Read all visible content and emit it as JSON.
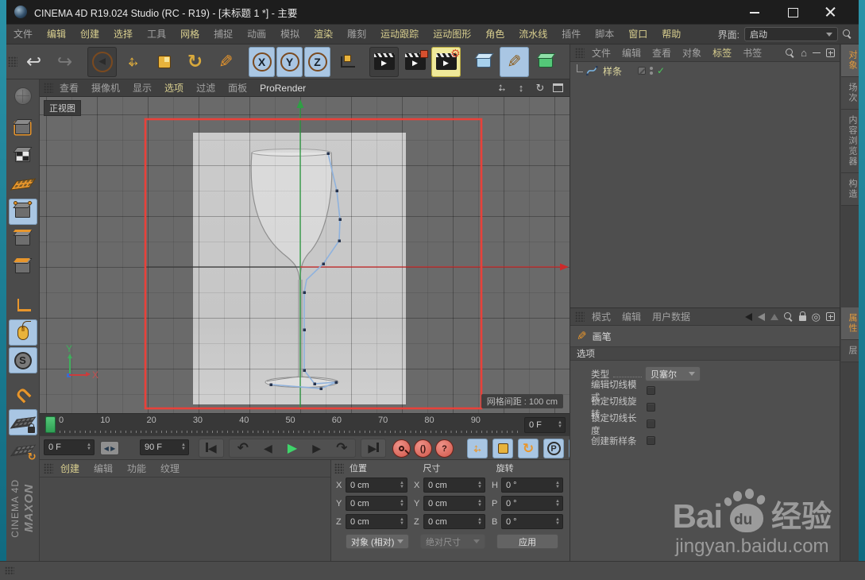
{
  "colors": {
    "desktop_teal": "#177f95",
    "accent_yellow": "#d9cf8f",
    "tab_active_orange": "#e09a3e",
    "render_frame_red": "#e8413a",
    "spline_blue": "#8fb2dd",
    "play_green": "#3fae5c",
    "record_red": "#d1574a",
    "toggle_blue": "#a9c6e3",
    "viewport_gray": "#6a6a6a",
    "reference_image_gray": "#c9c9c9"
  },
  "titlebar": {
    "title": "CINEMA 4D R19.024 Studio (RC - R19) - [未标题 1 *] - 主要"
  },
  "menubar": {
    "items": [
      {
        "label": "文件",
        "cls": "dim"
      },
      {
        "label": "编辑",
        "cls": "bright"
      },
      {
        "label": "创建",
        "cls": "bright"
      },
      {
        "label": "选择",
        "cls": "bright"
      },
      {
        "label": "工具",
        "cls": "dim"
      },
      {
        "label": "网格",
        "cls": "bright"
      },
      {
        "label": "捕捉",
        "cls": "dim"
      },
      {
        "label": "动画",
        "cls": "dim"
      },
      {
        "label": "模拟",
        "cls": "dim"
      },
      {
        "label": "渲染",
        "cls": "bright"
      },
      {
        "label": "雕刻",
        "cls": "dim"
      },
      {
        "label": "运动跟踪",
        "cls": "bright"
      },
      {
        "label": "运动图形",
        "cls": "bright"
      },
      {
        "label": "角色",
        "cls": "bright"
      },
      {
        "label": "流水线",
        "cls": "bright"
      },
      {
        "label": "插件",
        "cls": "dim"
      },
      {
        "label": "脚本",
        "cls": "dim"
      },
      {
        "label": "窗口",
        "cls": "bright"
      },
      {
        "label": "帮助",
        "cls": "bright"
      }
    ],
    "interface_label": "界面:",
    "interface_value": "启动"
  },
  "toolbar": {
    "axis": [
      "X",
      "Y",
      "Z"
    ]
  },
  "left_toolbar": {
    "snap_letter": "S",
    "maxon": "MAXON",
    "cinema": "CINEMA 4D"
  },
  "viewport": {
    "menu": [
      {
        "label": "查看",
        "cls": "dim"
      },
      {
        "label": "摄像机",
        "cls": "dim"
      },
      {
        "label": "显示",
        "cls": "dim"
      },
      {
        "label": "选项",
        "cls": "bright"
      },
      {
        "label": "过滤",
        "cls": "dim"
      },
      {
        "label": "面板",
        "cls": "dim"
      },
      {
        "label": "ProRender",
        "cls": "white"
      }
    ],
    "view_label": "正视图",
    "grid_spacing": "网格间距 : 100 cm",
    "axis_y": "Y",
    "axis_x": "X"
  },
  "object_manager": {
    "menu": [
      {
        "label": "文件",
        "cls": "dim"
      },
      {
        "label": "编辑",
        "cls": "dim"
      },
      {
        "label": "查看",
        "cls": "dim"
      },
      {
        "label": "对象",
        "cls": "dim"
      },
      {
        "label": "标签",
        "cls": "bright"
      },
      {
        "label": "书签",
        "cls": "dim"
      }
    ],
    "object_name": "样条"
  },
  "attribute_manager": {
    "menu": [
      "模式",
      "编辑",
      "用户数据"
    ],
    "tool_title": "画笔",
    "section": "选项",
    "type_label": "类型",
    "type_value": "贝塞尔",
    "checkboxes": [
      "编辑切线模式",
      "锁定切线旋转",
      "锁定切线长度",
      "创建新样条"
    ]
  },
  "right_tabs": {
    "top": [
      {
        "label": "对象",
        "cls": "active"
      },
      {
        "label": "场次"
      },
      {
        "label": "内容浏览器"
      },
      {
        "label": "构造"
      }
    ],
    "bottom": [
      {
        "label": "属性",
        "cls": "active"
      },
      {
        "label": "层"
      }
    ]
  },
  "timeline": {
    "ticks": [
      "0",
      "10",
      "20",
      "30",
      "40",
      "50",
      "60",
      "70",
      "80",
      "90"
    ],
    "frame_field": "0 F"
  },
  "transport": {
    "start_field": "0 F",
    "end_field": "90 F",
    "param_letter": "P",
    "question": "?",
    "parens": "()"
  },
  "materials": {
    "menu": [
      {
        "label": "创建",
        "cls": "bright"
      },
      {
        "label": "编辑",
        "cls": "dim"
      },
      {
        "label": "功能",
        "cls": "dim"
      },
      {
        "label": "纹理",
        "cls": "dim"
      }
    ]
  },
  "coordinates": {
    "position_label": "位置",
    "size_label": "尺寸",
    "rotation_label": "旋转",
    "rows": [
      {
        "pl": "X",
        "pv": "0 cm",
        "sl": "X",
        "sv": "0 cm",
        "rl": "H",
        "rv": "0 °"
      },
      {
        "pl": "Y",
        "pv": "0 cm",
        "sl": "Y",
        "sv": "0 cm",
        "rl": "P",
        "rv": "0 °"
      },
      {
        "pl": "Z",
        "pv": "0 cm",
        "sl": "Z",
        "sv": "0 cm",
        "rl": "B",
        "rv": "0 °"
      }
    ],
    "mode_dropdown": "对象 (相对)",
    "size_dropdown": "绝对尺寸",
    "apply_button": "应用"
  },
  "watermark": {
    "bai": "Bai",
    "du": "du",
    "jingyan": "经验",
    "url": "jingyan.baidu.com"
  }
}
